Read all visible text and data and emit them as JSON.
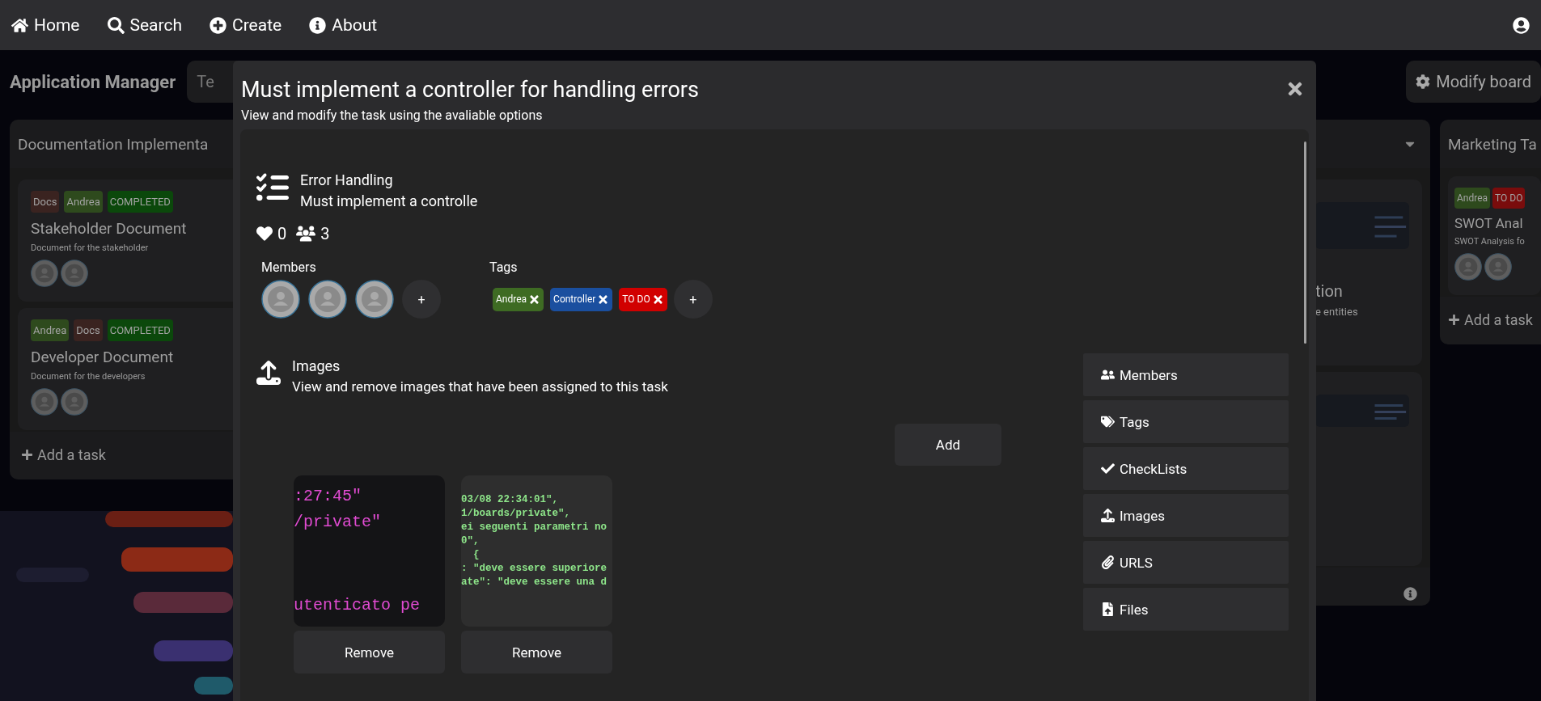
{
  "nav": {
    "items": [
      {
        "label": "Home",
        "kind": "home"
      },
      {
        "label": "Search",
        "kind": "search"
      },
      {
        "label": "Create",
        "kind": "create"
      },
      {
        "label": "About",
        "kind": "about"
      }
    ]
  },
  "board": {
    "title": "Application Manager",
    "search": {
      "placeholder": "Te"
    },
    "modify_button": "Modify board",
    "columns": [
      {
        "kind": "full",
        "title": "Documentation Implementa",
        "tasks": [
          {
            "tags": [
              {
                "label": "Docs",
                "color": "#3a2320"
              },
              {
                "label": "Andrea",
                "color": "#2e4a1d"
              },
              {
                "label": "COMPLETED",
                "color": "#0b480b"
              }
            ],
            "title": "Stakeholder Document",
            "description": "Document for the stakeholder",
            "members": [
              {
                "kind": "avatar"
              },
              {
                "kind": "avatar"
              }
            ]
          },
          {
            "tags": [
              {
                "label": "Andrea",
                "color": "#2e4a1d"
              },
              {
                "label": "Docs",
                "color": "#3a2320"
              },
              {
                "label": "COMPLETED",
                "color": "#0b480b"
              }
            ],
            "title": "Developer Document",
            "description": "Document for the developers",
            "members": [
              {
                "kind": "avatar"
              },
              {
                "kind": "avatar"
              }
            ]
          }
        ],
        "add_label": "Add a task"
      },
      {
        "kind": "partial",
        "tasks": [
          {
            "cover": {
              "kind": "picture"
            },
            "title": "tion",
            "description": "e entities"
          },
          {
            "cover": {
              "kind": "picture"
            }
          }
        ]
      },
      {
        "kind": "edge",
        "title": "Marketing Ta",
        "tasks": [
          {
            "tags": [
              {
                "label": "Andrea",
                "color": "#2e4a1d"
              },
              {
                "label": "TO DO",
                "color": "#7a0c0c"
              }
            ],
            "title": "SWOT Anal",
            "description": "SWOT Analysis fo",
            "members": [
              {
                "kind": "avatar"
              },
              {
                "kind": "avatar"
              }
            ]
          }
        ],
        "add_label": "Add a task"
      }
    ]
  },
  "modal": {
    "title": "Must implement a controller for handling errors",
    "subtitle": "View and modify the task using the avaliable options",
    "task": {
      "name": "Error Handling",
      "description": "Must implement a controlle",
      "likes": "0",
      "member_count": "3"
    },
    "members": {
      "label": "Members",
      "avatars": [
        {
          "kind": "avatar"
        },
        {
          "kind": "avatar"
        },
        {
          "kind": "avatar"
        }
      ],
      "add": "+"
    },
    "tags": {
      "label": "Tags",
      "items": [
        {
          "label": "Andrea",
          "color": "#3e6b23"
        },
        {
          "label": "Controller",
          "color": "#1a4f9f"
        },
        {
          "label": "TO DO",
          "color": "#d10000"
        }
      ],
      "add": "+"
    },
    "images": {
      "title": "Images",
      "description": "View and remove images that have been assigned to this task",
      "add_button": "Add",
      "items": [
        {
          "kind": "pink",
          "lines": [
            ":27:45\"",
            "/private\"",
            "utenticato pe"
          ],
          "remove": "Remove"
        },
        {
          "kind": "green",
          "lines": [
            "03/08 22:34:01\",",
            "1/boards/private\",",
            "ei seguenti parametri no",
            "0\",",
            "  {",
            ": \"deve essere superiore",
            "ate\": \"deve essere una d"
          ],
          "remove": "Remove"
        }
      ]
    },
    "options": [
      {
        "label": "Members",
        "kind": "members"
      },
      {
        "label": "Tags",
        "kind": "tags"
      },
      {
        "label": "CheckLists",
        "kind": "checklists"
      },
      {
        "label": "Images",
        "kind": "images"
      },
      {
        "label": "URLS",
        "kind": "urls"
      },
      {
        "label": "Files",
        "kind": "files"
      }
    ]
  }
}
